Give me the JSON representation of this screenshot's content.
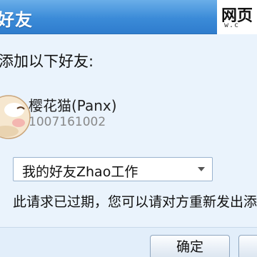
{
  "window": {
    "title": "好友",
    "watermark_text": "网页",
    "watermark_url": "w.c"
  },
  "dialog": {
    "instruction": "添加以下好友:",
    "friend": {
      "name": "樱花猫(Panx)",
      "id": "1007161002"
    },
    "group_select": {
      "value": "我的好友Zhao工作"
    },
    "status_message": "此请求已过期，您可以请对方重新发出添"
  },
  "footer": {
    "ok_label": "确定",
    "other_label": ""
  },
  "colors": {
    "titlebar": "#3b8bd8",
    "background": "#eaf3fc"
  }
}
